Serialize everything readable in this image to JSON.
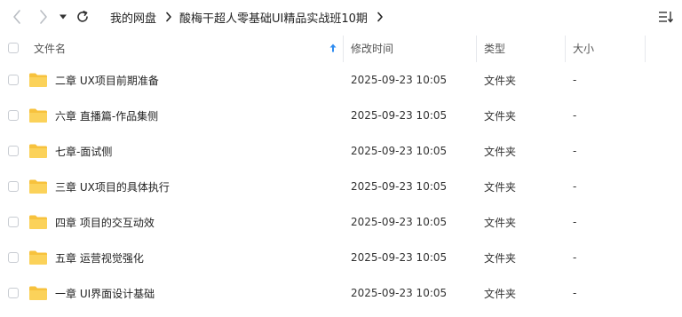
{
  "nav": {
    "back_icon": "chevron-left-icon",
    "forward_icon": "chevron-right-icon",
    "dropdown_icon": "caret-down-icon",
    "refresh_icon": "refresh-icon",
    "list_mode_icon": "list-sort-icon"
  },
  "breadcrumb": {
    "root": "我的网盘",
    "current": "酸梅干超人零基础UI精品实战班10期",
    "separator_icon": "chevron-right-icon"
  },
  "table": {
    "headers": {
      "name": "文件名",
      "modified": "修改时间",
      "type": "类型",
      "size": "大小"
    },
    "sort_icon": "sort-up-arrow-icon",
    "sort_color": "#2f8cf0",
    "folder_color": "#f7c23d",
    "rows": [
      {
        "name": "二章 UX项目前期准备",
        "modified": "2025-09-23 10:05",
        "type": "文件夹",
        "size": "-"
      },
      {
        "name": "六章 直播篇-作品集侧",
        "modified": "2025-09-23 10:05",
        "type": "文件夹",
        "size": "-"
      },
      {
        "name": "七章-面试侧",
        "modified": "2025-09-23 10:05",
        "type": "文件夹",
        "size": "-"
      },
      {
        "name": "三章 UX项目的具体执行",
        "modified": "2025-09-23 10:05",
        "type": "文件夹",
        "size": "-"
      },
      {
        "name": "四章 项目的交互动效",
        "modified": "2025-09-23 10:05",
        "type": "文件夹",
        "size": "-"
      },
      {
        "name": "五章 运营视觉强化",
        "modified": "2025-09-23 10:05",
        "type": "文件夹",
        "size": "-"
      },
      {
        "name": "一章 UI界面设计基础",
        "modified": "2025-09-23 10:05",
        "type": "文件夹",
        "size": "-"
      }
    ]
  }
}
